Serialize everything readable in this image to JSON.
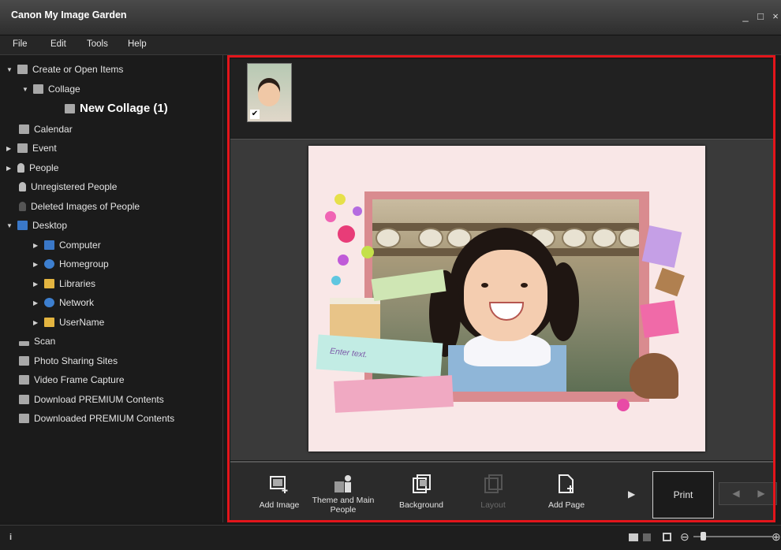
{
  "window": {
    "title": "Canon My Image Garden",
    "controls": [
      "_",
      "□",
      "×"
    ]
  },
  "menubar": [
    "File",
    "Edit",
    "Tools",
    "Help"
  ],
  "tree": [
    {
      "label": "Create or Open Items",
      "arrow": "▼",
      "icon": "create-icon"
    },
    {
      "label": "Collage",
      "arrow": "▼",
      "icon": "collage-icon"
    },
    {
      "label": "New Collage (1)",
      "arrow": "",
      "icon": "collage-item-icon"
    },
    {
      "label": "Calendar",
      "arrow": "",
      "icon": "calendar-icon"
    },
    {
      "label": "Event",
      "arrow": "▶",
      "icon": "event-icon"
    },
    {
      "label": "People",
      "arrow": "▶",
      "icon": "people-icon"
    },
    {
      "label": "Unregistered People",
      "arrow": "",
      "icon": "unregistered-people-icon"
    },
    {
      "label": "Deleted Images of People",
      "arrow": "",
      "icon": "deleted-people-icon"
    },
    {
      "label": "Desktop",
      "arrow": "▼",
      "icon": "desktop-icon"
    },
    {
      "label": "Computer",
      "arrow": "▶",
      "icon": "computer-icon"
    },
    {
      "label": "Homegroup",
      "arrow": "▶",
      "icon": "homegroup-icon"
    },
    {
      "label": "Libraries",
      "arrow": "▶",
      "icon": "libraries-icon"
    },
    {
      "label": "Network",
      "arrow": "▶",
      "icon": "network-icon"
    },
    {
      "label": "UserName",
      "arrow": "▶",
      "icon": "user-folder-icon"
    },
    {
      "label": "Scan",
      "arrow": "",
      "icon": "scan-icon"
    },
    {
      "label": "Photo Sharing Sites",
      "arrow": "",
      "icon": "photo-sharing-icon"
    },
    {
      "label": "Video Frame Capture",
      "arrow": "",
      "icon": "video-capture-icon"
    },
    {
      "label": "Download PREMIUM Contents",
      "arrow": "",
      "icon": "download-premium-icon"
    },
    {
      "label": "Downloaded PREMIUM Contents",
      "arrow": "",
      "icon": "downloaded-premium-icon"
    }
  ],
  "thumbnail": {
    "checked": "✔"
  },
  "collage": {
    "text_placeholder": "Enter text."
  },
  "toolbar": {
    "add_image": "Add Image",
    "theme_main_people": "Theme and Main People",
    "background": "Background",
    "layout": "Layout",
    "add_page": "Add Page",
    "more": "▶",
    "print": "Print",
    "prev": "◀",
    "next": "▶"
  },
  "statusbar": {
    "info": "i",
    "zoom_out": "⊖",
    "zoom_in": "⊕"
  },
  "colors": {
    "highlight": "#e3151b",
    "page_bg": "#f9e7e7",
    "frame": "#d98b8f"
  }
}
